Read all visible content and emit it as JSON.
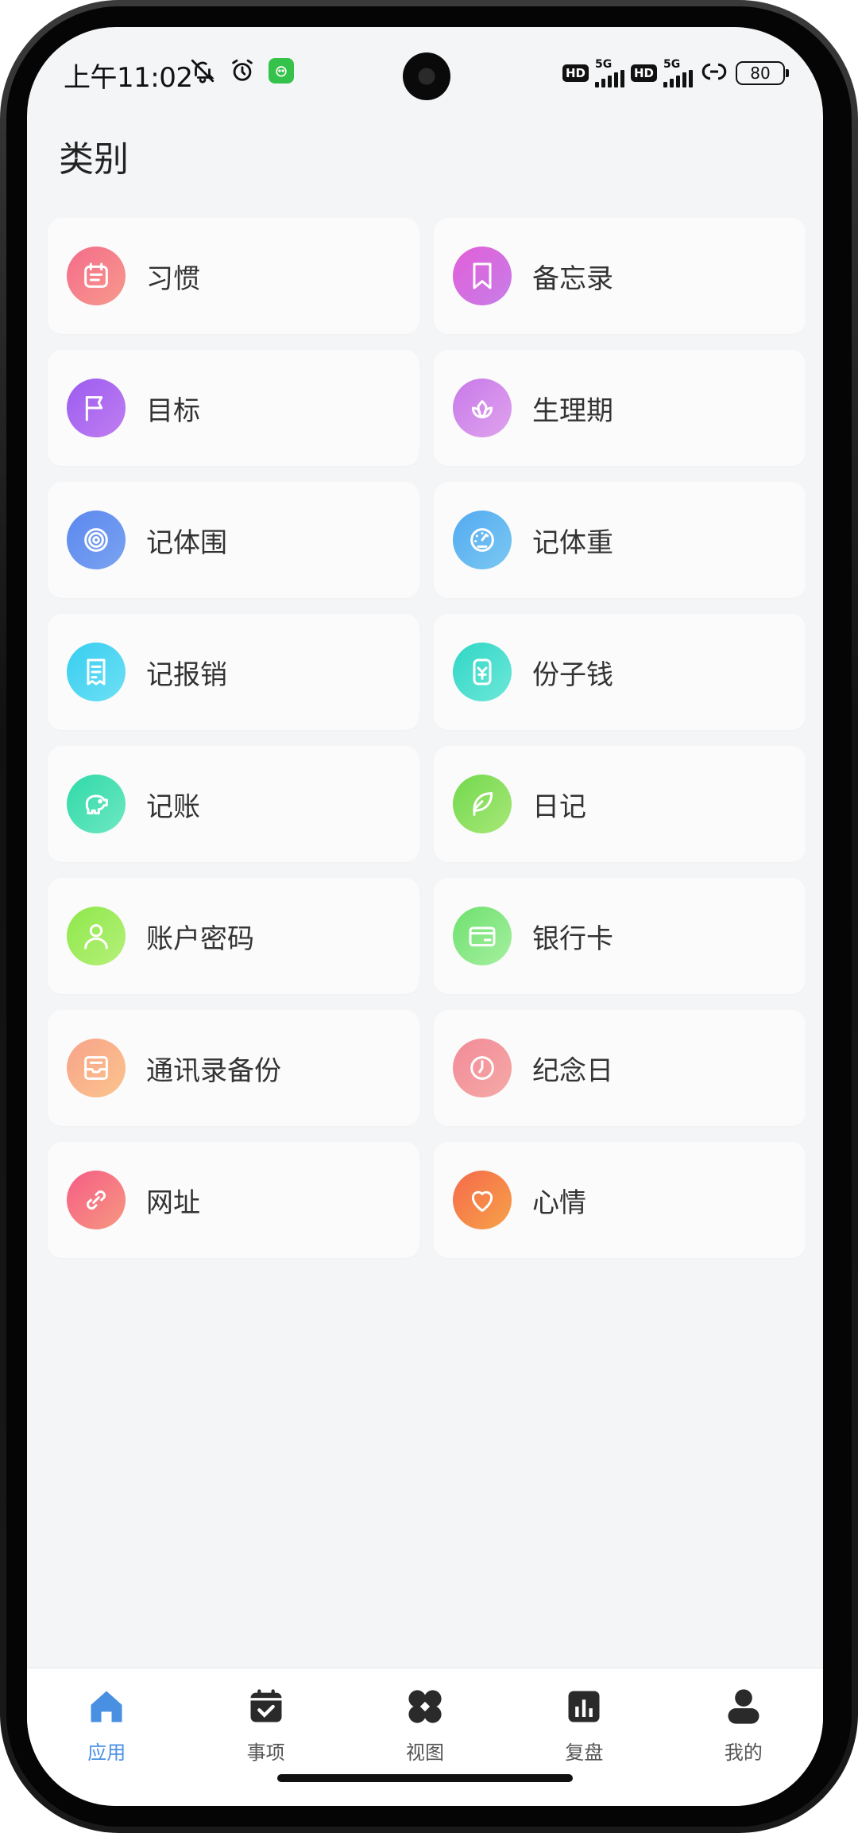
{
  "status_bar": {
    "time": "上午11:02",
    "hd_label": "HD",
    "network_label": "5G",
    "battery": "80"
  },
  "page": {
    "title": "类别"
  },
  "categories": [
    {
      "label": "习惯",
      "icon": "calendar-icon",
      "colors": [
        "#f46b8a",
        "#f79a8d"
      ]
    },
    {
      "label": "备忘录",
      "icon": "bookmark-icon",
      "colors": [
        "#e25ed8",
        "#c77ee8"
      ]
    },
    {
      "label": "目标",
      "icon": "flag-icon",
      "colors": [
        "#9b5cf0",
        "#c07ef0"
      ]
    },
    {
      "label": "生理期",
      "icon": "lotus-icon",
      "colors": [
        "#c779e8",
        "#e0a3ee"
      ]
    },
    {
      "label": "记体围",
      "icon": "target-icon",
      "colors": [
        "#5b88ef",
        "#7aa3f0"
      ]
    },
    {
      "label": "记体重",
      "icon": "gauge-icon",
      "colors": [
        "#52aaf0",
        "#7cc8f2"
      ]
    },
    {
      "label": "记报销",
      "icon": "receipt-icon",
      "colors": [
        "#37cdf0",
        "#6ee0f5"
      ]
    },
    {
      "label": "份子钱",
      "icon": "money-jar-icon",
      "colors": [
        "#2fd6c6",
        "#6ee8d9"
      ]
    },
    {
      "label": "记账",
      "icon": "piggy-bank-icon",
      "colors": [
        "#2fd9a8",
        "#6ee8c2"
      ]
    },
    {
      "label": "日记",
      "icon": "feather-icon",
      "colors": [
        "#72d84d",
        "#a8e878"
      ]
    },
    {
      "label": "账户密码",
      "icon": "user-icon",
      "colors": [
        "#8de84a",
        "#b6f07a"
      ]
    },
    {
      "label": "银行卡",
      "icon": "card-icon",
      "colors": [
        "#6ee06e",
        "#a6f0a0"
      ]
    },
    {
      "label": "通讯录备份",
      "icon": "inbox-icon",
      "colors": [
        "#f7a38a",
        "#fbc48d"
      ]
    },
    {
      "label": "纪念日",
      "icon": "clock-icon",
      "colors": [
        "#f28b98",
        "#f5a9a6"
      ]
    },
    {
      "label": "网址",
      "icon": "link-icon",
      "colors": [
        "#f55d86",
        "#f79880"
      ]
    },
    {
      "label": "心情",
      "icon": "heart-icon",
      "colors": [
        "#f56a4a",
        "#f7a24a"
      ]
    }
  ],
  "tabbar": {
    "active_color": "#4a90e2",
    "tabs": [
      {
        "label": "应用",
        "icon": "home-icon",
        "active": true
      },
      {
        "label": "事项",
        "icon": "calendar-check-icon",
        "active": false
      },
      {
        "label": "视图",
        "icon": "clover-grid-icon",
        "active": false
      },
      {
        "label": "复盘",
        "icon": "bar-chart-icon",
        "active": false
      },
      {
        "label": "我的",
        "icon": "person-icon",
        "active": false
      }
    ]
  }
}
